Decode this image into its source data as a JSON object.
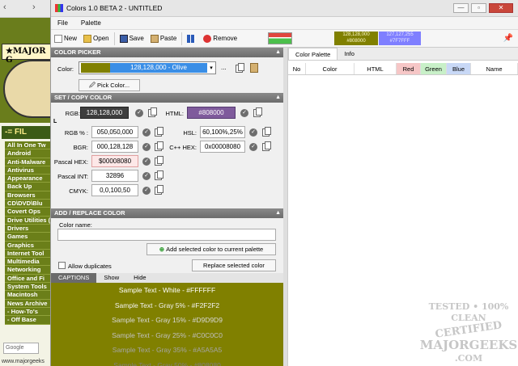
{
  "browser": {
    "chevron": "›",
    "brand_prefix": "★MAJOR G",
    "files_header": "-= FIL",
    "nav_items": [
      "All In One Tw",
      "Android",
      "Anti-Malware",
      "Antivirus",
      "Appearance",
      "Back Up",
      "Browsers",
      "CD\\DVD\\Blu",
      "Covert Ops",
      "Drive Utilities (USB, DVD)",
      "Drivers",
      "Games",
      "Graphics",
      "Internet Tool",
      "Multimedia",
      "Networking",
      "Office and Fi",
      "System Tools",
      "Macintosh",
      "News Archive",
      "- How-To's",
      "- Off Base"
    ],
    "search_placeholder": "Google",
    "url": "www.majorgeeks"
  },
  "window": {
    "title": "Colors 1.0 BETA 2 - UNTITLED",
    "minimize": "—",
    "maximize": "▫",
    "close": "✕"
  },
  "menu": [
    "File",
    "Palette"
  ],
  "toolbar": {
    "new": "New",
    "open": "Open",
    "save": "Save",
    "paste": "Paste",
    "remove": "Remove",
    "current_color_text_1": "128,128,000\n#808000",
    "current_color_text_2": "127,127,255\n#7F7FFF"
  },
  "color_picker": {
    "section": "COLOR PICKER",
    "color_label": "Color:",
    "selected": "128,128,000 - Olive",
    "ellipsis": "...",
    "pick_button": "Pick Color..."
  },
  "set_copy": {
    "section": "SET / COPY COLOR",
    "rgb_label": "RGB:",
    "rgb_value": "128,128,000",
    "html_label": "HTML:",
    "html_value": "#808000",
    "rgb_pct_label": "RGB % :",
    "rgb_pct_value": "050,050,000",
    "hsl_label": "HSL:",
    "hsl_value": "60,100%,25%",
    "bgr_label": "BGR:",
    "bgr_value": "000,128,128",
    "cpp_label": "C++ HEX:",
    "cpp_value": "0x00008080",
    "pascal_hex_label": "Pascal HEX:",
    "pascal_hex_value": "$00008080",
    "pascal_int_label": "Pascal INT:",
    "pascal_int_value": "32896",
    "cmyk_label": "CMYK:",
    "cmyk_value": "0,0,100,50",
    "corner": "L"
  },
  "add_replace": {
    "section": "ADD / REPLACE COLOR",
    "name_label": "Color name:",
    "name_value": "",
    "add_button": "Add selected color to current palette",
    "allow_dupes": "Allow duplicates",
    "replace_button": "Replace selected color"
  },
  "captions": {
    "tabs": [
      "CAPTIONS",
      "Show",
      "Hide"
    ],
    "samples": [
      {
        "text": "Sample Text - White - #FFFFFF",
        "color": "#FFFFFF"
      },
      {
        "text": "Sample Text - Gray 5% - #F2F2F2",
        "color": "#F2F2F2"
      },
      {
        "text": "Sample Text - Gray 15% - #D9D9D9",
        "color": "#D9D9D9"
      },
      {
        "text": "Sample Text - Gray 25% - #C0C0C0",
        "color": "#C0C0C0"
      },
      {
        "text": "Sample Text - Gray 35% - #A5A5A5",
        "color": "#A5A5A5"
      },
      {
        "text": "Sample Text - Gray 50% - #808080",
        "color": "#808080"
      }
    ]
  },
  "palette": {
    "tabs": [
      "Color Palette",
      "Info"
    ],
    "columns": [
      {
        "label": "No",
        "bg": "#ffffff"
      },
      {
        "label": "Color",
        "bg": "#ffffff"
      },
      {
        "label": "HTML",
        "bg": "#ffffff"
      },
      {
        "label": "Red",
        "bg": "#f6c6c6"
      },
      {
        "label": "Green",
        "bg": "#c8f0c8"
      },
      {
        "label": "Blue",
        "bg": "#c8d8f6"
      },
      {
        "label": "Name",
        "bg": "#ffffff"
      }
    ]
  },
  "watermark": {
    "line1": "TESTED • 100% CLEAN",
    "line2": "CERTIFIED",
    "line3": "MAJORGEEKS",
    "line4": ".COM"
  },
  "colors": {
    "olive": "#808000",
    "html_swatch": "#7f5b9c",
    "rgb_swatch": "#3e3e3e",
    "select_blue": "#3a8ee6"
  }
}
